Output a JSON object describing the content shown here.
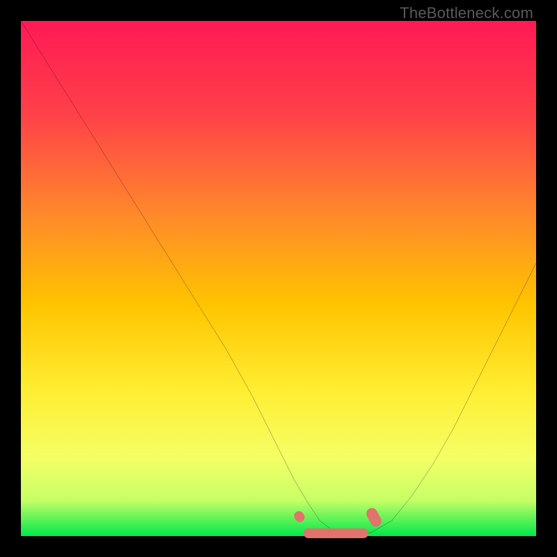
{
  "watermark": "TheBottleneck.com",
  "colors": {
    "frame": "#000000",
    "gradient_top": "#ff1a55",
    "gradient_mid1": "#ff7a3a",
    "gradient_mid2": "#ffd400",
    "gradient_mid3": "#ffff66",
    "gradient_bottom": "#00e84a",
    "curve": "#000000",
    "marker": "#e0736c",
    "watermark": "#5a5a5a"
  },
  "chart_data": {
    "type": "line",
    "title": "",
    "xlabel": "",
    "ylabel": "",
    "xlim": [
      0,
      100
    ],
    "ylim": [
      0,
      100
    ],
    "grid": false,
    "legend": false,
    "series": [
      {
        "name": "bottleneck-curve",
        "x": [
          0,
          5,
          10,
          15,
          20,
          25,
          30,
          35,
          40,
          45,
          50,
          53,
          56,
          58,
          60,
          62,
          64,
          66,
          68,
          72,
          76,
          80,
          84,
          88,
          92,
          96,
          100
        ],
        "values": [
          100,
          92,
          84,
          76,
          68,
          60,
          52,
          44,
          36,
          27,
          17,
          11,
          6,
          3,
          1.5,
          0.7,
          0.3,
          0.3,
          0.7,
          3,
          8,
          14,
          21,
          29,
          37,
          45,
          53
        ]
      }
    ],
    "optimal_range_x": [
      56,
      68
    ],
    "annotations": []
  }
}
